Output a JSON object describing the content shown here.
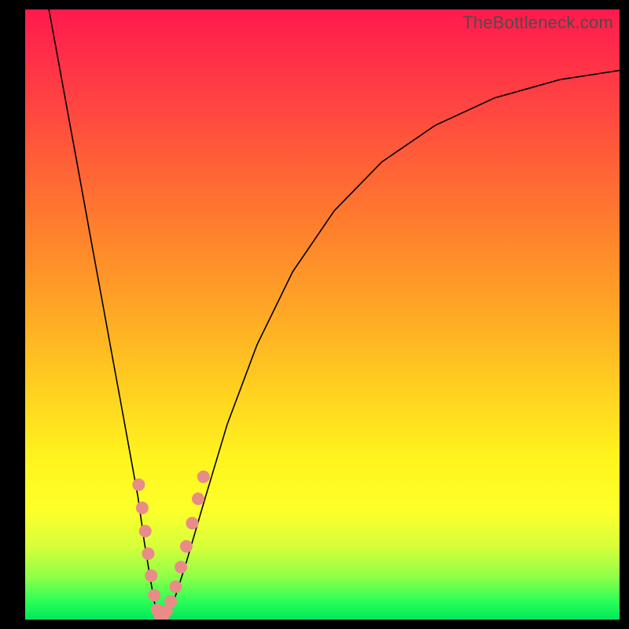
{
  "watermark": "TheBottleneck.com",
  "chart_data": {
    "type": "line",
    "title": "",
    "xlabel": "",
    "ylabel": "",
    "xlim": [
      0,
      100
    ],
    "ylim": [
      0,
      100
    ],
    "grid": false,
    "legend": false,
    "series": [
      {
        "name": "left-branch",
        "x": [
          4,
          5.5,
          7,
          8.5,
          10,
          11.5,
          13,
          14.5,
          16,
          17.5,
          19,
          20,
          21,
          21.7,
          22.3
        ],
        "values": [
          100,
          92,
          84,
          76,
          68,
          60,
          52,
          44,
          36,
          28,
          20,
          13,
          7,
          3,
          0.5
        ]
      },
      {
        "name": "right-branch",
        "x": [
          23.5,
          25,
          27,
          30,
          34,
          39,
          45,
          52,
          60,
          69,
          79,
          90,
          100
        ],
        "values": [
          0.5,
          3,
          9,
          19,
          32,
          45,
          57,
          67,
          75,
          81,
          85.5,
          88.5,
          90
        ]
      }
    ],
    "markers": {
      "name": "sample-dots",
      "color": "#e98c87",
      "radius": 8,
      "points": [
        {
          "x": 19.1,
          "y": 22.1
        },
        {
          "x": 19.7,
          "y": 18.3
        },
        {
          "x": 20.2,
          "y": 14.5
        },
        {
          "x": 20.7,
          "y": 10.8
        },
        {
          "x": 21.2,
          "y": 7.2
        },
        {
          "x": 21.7,
          "y": 4.0
        },
        {
          "x": 22.2,
          "y": 1.6
        },
        {
          "x": 22.7,
          "y": 0.6
        },
        {
          "x": 23.2,
          "y": 0.6
        },
        {
          "x": 23.8,
          "y": 1.4
        },
        {
          "x": 24.5,
          "y": 3.0
        },
        {
          "x": 25.3,
          "y": 5.4
        },
        {
          "x": 26.2,
          "y": 8.6
        },
        {
          "x": 27.1,
          "y": 12.0
        },
        {
          "x": 28.1,
          "y": 15.8
        },
        {
          "x": 29.1,
          "y": 19.8
        },
        {
          "x": 30.0,
          "y": 23.4
        }
      ]
    },
    "background_gradient": {
      "top": "#ff1a4d",
      "upper_mid": "#ff7a2e",
      "mid": "#ffe01f",
      "lower_mid": "#d7ff3a",
      "bottom": "#00e85b"
    }
  }
}
